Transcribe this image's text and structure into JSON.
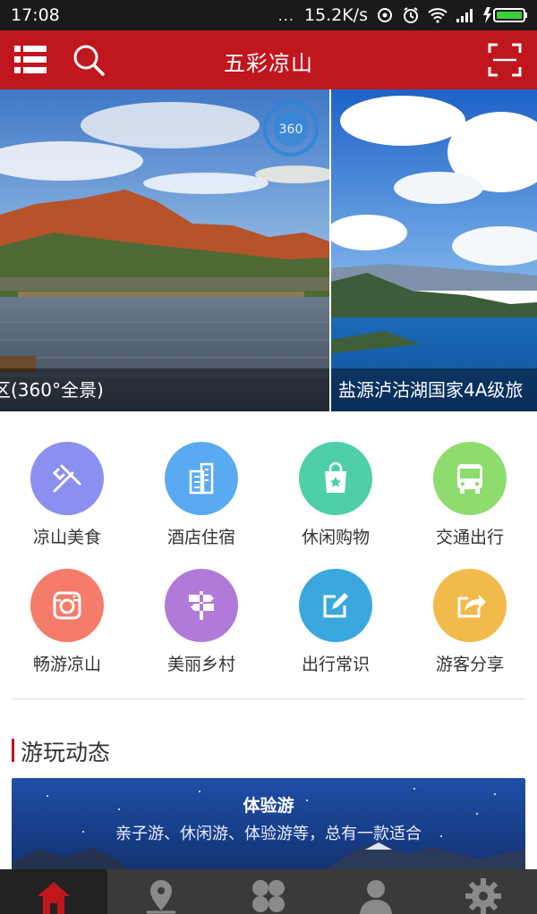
{
  "status_bar": {
    "time": "17:08",
    "signal_dots": "...",
    "network_speed": "15.2K/s",
    "icons": [
      "data-saver-icon",
      "alarm-icon",
      "wifi-icon",
      "cell-signal-icon",
      "battery-charging-icon"
    ]
  },
  "header": {
    "title": "五彩凉山",
    "menu_icon": "grid-list-icon",
    "search_icon": "search-icon",
    "scan_icon": "scan-icon"
  },
  "banner": {
    "slides": [
      {
        "caption": "区(360°全景)",
        "badge": "360"
      },
      {
        "caption": "盐源泸沽湖国家4A级旅"
      }
    ],
    "dot_count": 3,
    "active_dot": 0
  },
  "categories": [
    {
      "label": "凉山美食",
      "icon": "utensils-icon",
      "color": "#8a8ff0"
    },
    {
      "label": "酒店住宿",
      "icon": "building-icon",
      "color": "#5aaaf2"
    },
    {
      "label": "休闲购物",
      "icon": "shopping-bag-icon",
      "color": "#4fcfa8"
    },
    {
      "label": "交通出行",
      "icon": "bus-icon",
      "color": "#8edc6e"
    },
    {
      "label": "畅游凉山",
      "icon": "camera-icon",
      "color": "#f57b6a"
    },
    {
      "label": "美丽乡村",
      "icon": "signpost-icon",
      "color": "#b27ad8"
    },
    {
      "label": "出行常识",
      "icon": "edit-icon",
      "color": "#3aa8de"
    },
    {
      "label": "游客分享",
      "icon": "share-icon",
      "color": "#f0bb4a"
    }
  ],
  "section": {
    "title": "游玩动态"
  },
  "promo": {
    "title": "体验游",
    "subtitle": "亲子游、休闲游、体验游等，总有一款适合"
  },
  "bottom_nav": [
    {
      "icon": "home-icon",
      "active": true
    },
    {
      "icon": "map-pin-icon",
      "active": false
    },
    {
      "icon": "apps-icon",
      "active": false
    },
    {
      "icon": "user-icon",
      "active": false
    },
    {
      "icon": "settings-icon",
      "active": false
    }
  ],
  "colors": {
    "brand_red": "#c0161e",
    "nav_bg": "#3a3a3a",
    "active_dot": "#f0a020"
  }
}
